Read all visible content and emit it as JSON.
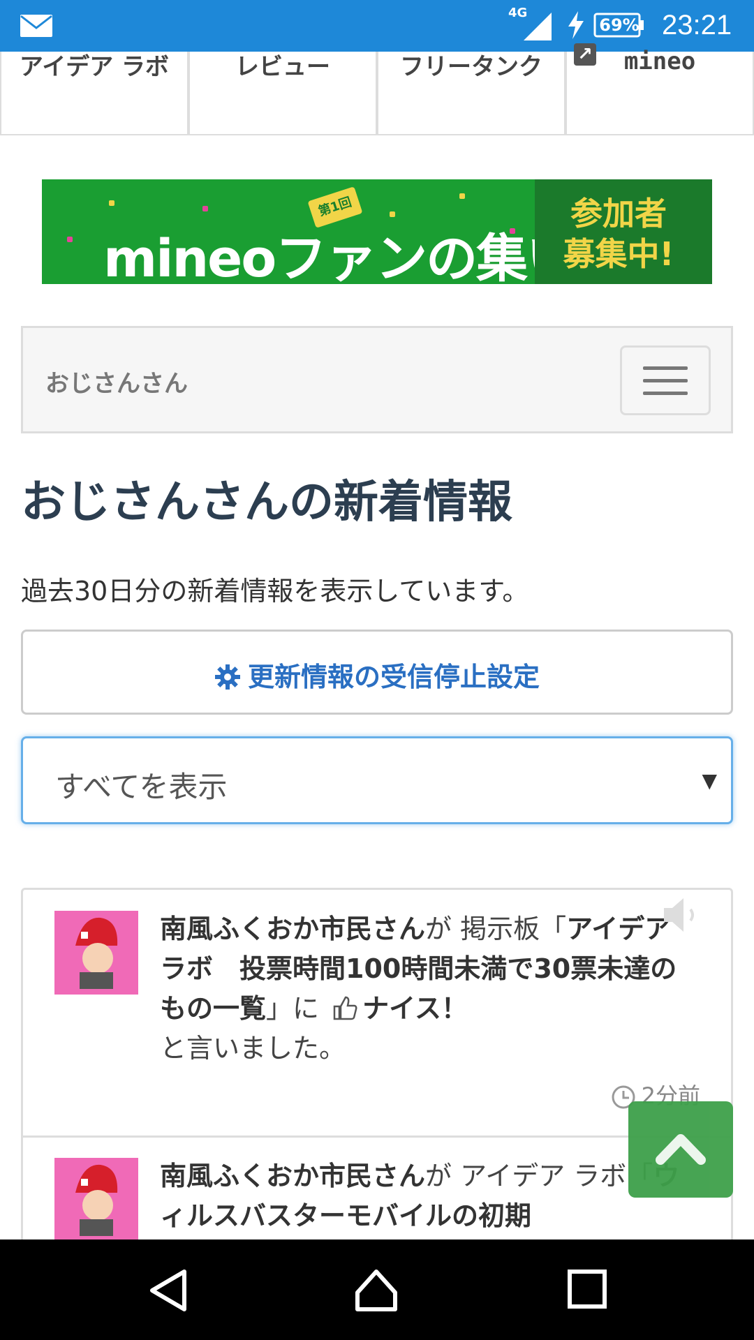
{
  "status_bar": {
    "network": "4G",
    "battery": "69%",
    "time": "23:21"
  },
  "tabs": [
    {
      "label": "アイデア ラボ"
    },
    {
      "label": "レビュー"
    },
    {
      "label": "フリータンク"
    },
    {
      "label": "mineo"
    }
  ],
  "banner": {
    "badge": "第1回",
    "brand": "mineoファンの集い",
    "cta_line1": "参加者",
    "cta_line2": "募集中!"
  },
  "user_nav": {
    "name": "おじさんさん"
  },
  "page": {
    "title": "おじさんさんの新着情報",
    "description": "過去30日分の新着情報を表示しています。",
    "unsubscribe_label": "更新情報の受信停止設定",
    "filter_value": "すべてを表示"
  },
  "feed": [
    {
      "user": "南風ふくおか市民さん",
      "particle": "が",
      "board": "掲示板「",
      "thread_title": "アイデアラボ　投票時間100時間未満で30票未達のもの一覧",
      "close": "」に",
      "action": "ナイス！",
      "tail": "と言いました。",
      "time": "2分前"
    },
    {
      "user": "南風ふくおか市民さん",
      "particle": "が",
      "board": "アイデア ラボ「",
      "thread_title": "ウィルスバスターモバイルの初期"
    }
  ],
  "colors": {
    "status_bar": "#1e88d8",
    "banner_green": "#1a9e32",
    "link_blue": "#2a6fc2",
    "to_top_green": "#3ea04a",
    "avatar_pink": "#f06ab7"
  }
}
